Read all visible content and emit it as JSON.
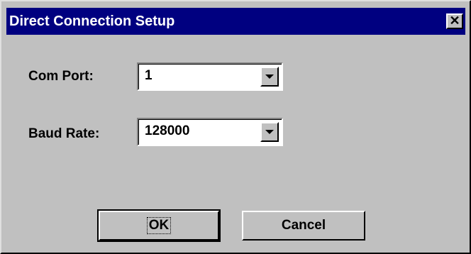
{
  "window": {
    "title": "Direct Connection Setup",
    "close_glyph": "✕"
  },
  "form": {
    "com_port": {
      "label": "Com Port:",
      "value": "1"
    },
    "baud_rate": {
      "label": "Baud Rate:",
      "value": "128000"
    }
  },
  "buttons": {
    "ok_label": "OK",
    "cancel_label": "Cancel"
  },
  "colors": {
    "title_bar": "#000080",
    "face": "#c0c0c0",
    "field": "#ffffff"
  },
  "icons": {
    "close": "close-icon",
    "dropdown": "chevron-down-icon"
  }
}
